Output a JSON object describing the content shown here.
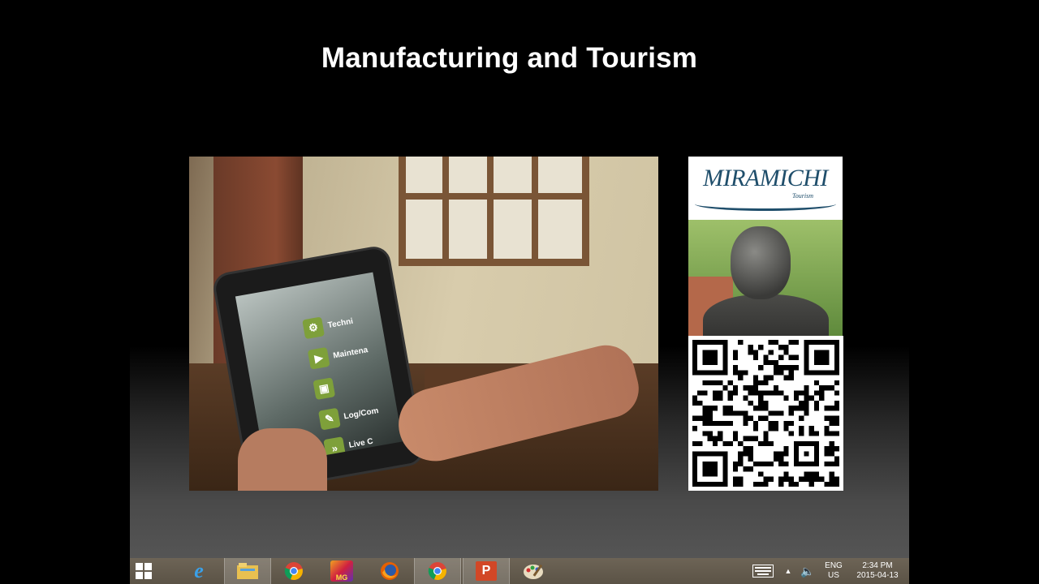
{
  "slide": {
    "title": "Manufacturing and Tourism"
  },
  "video": {
    "menu_items": [
      {
        "label": "Techni",
        "icon": "gear-icon"
      },
      {
        "label": "Maintena",
        "icon": "play-icon"
      },
      {
        "label": "",
        "icon": "cube-icon"
      },
      {
        "label": "Log/Com",
        "icon": "comment-icon"
      },
      {
        "label": "Live C",
        "icon": "forward-icon"
      }
    ]
  },
  "logo": {
    "name": "MIRAMICHI",
    "sub": "Tourism"
  },
  "taskbar": {
    "apps": [
      "start-icon",
      "internet-explorer-icon",
      "file-explorer-icon",
      "chrome-icon",
      "game-icon",
      "firefox-icon",
      "chrome-icon",
      "powerpoint-icon",
      "paint-icon"
    ],
    "game_label": "MG",
    "language": "ENG",
    "region": "US",
    "time": "2:34 PM",
    "date": "2015-04-13"
  },
  "colors": {
    "accent_green": "#7ea03a",
    "logo_blue": "#1f4e6b"
  }
}
